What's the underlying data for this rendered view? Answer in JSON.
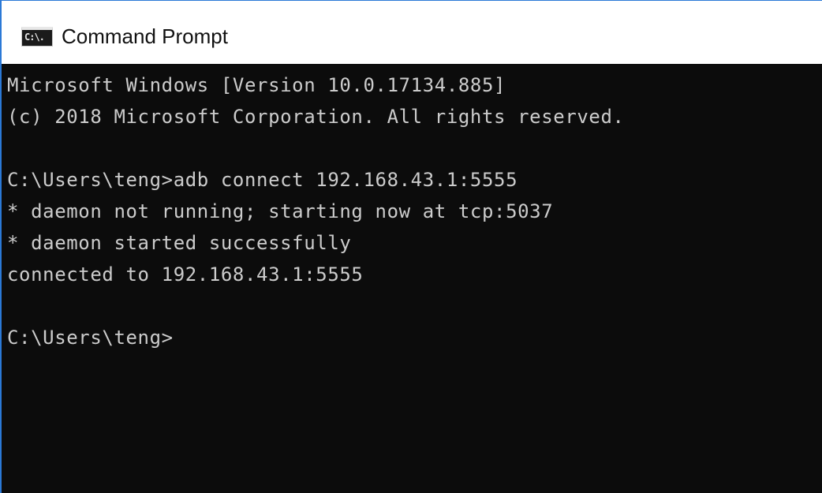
{
  "window": {
    "title": "Command Prompt",
    "icon": "cmd-icon",
    "icon_glyph": "C:\\."
  },
  "console": {
    "lines": [
      "Microsoft Windows [Version 10.0.17134.885]",
      "(c) 2018 Microsoft Corporation. All rights reserved.",
      "",
      "C:\\Users\\teng>adb connect 192.168.43.1:5555",
      "* daemon not running; starting now at tcp:5037",
      "* daemon started successfully",
      "connected to 192.168.43.1:5555",
      "",
      "C:\\Users\\teng>"
    ]
  },
  "colors": {
    "console_background": "#0c0c0c",
    "console_text": "#cccccc",
    "titlebar_background": "#ffffff",
    "window_border": "#2b79d6"
  }
}
